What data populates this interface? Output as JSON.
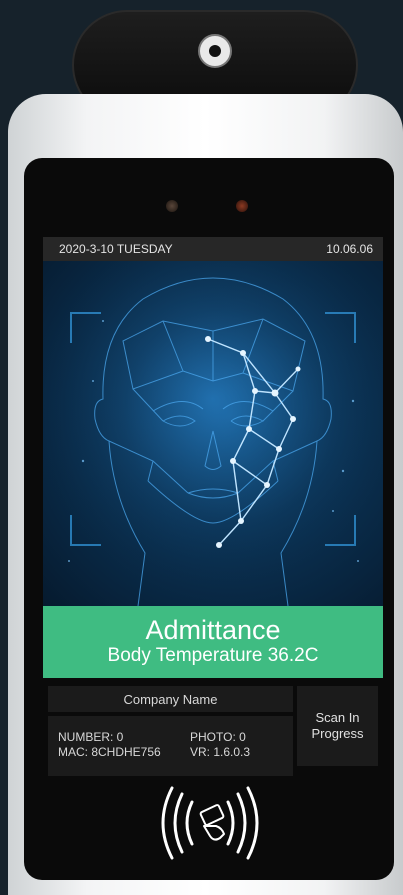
{
  "status_bar": {
    "date": "2020-3-10 TUESDAY",
    "time": "10.06.06"
  },
  "result": {
    "title": "Admittance",
    "subtitle": "Body Temperature 36.2C"
  },
  "info": {
    "company": "Company Name",
    "number": "NUMBER: 0",
    "photo": "PHOTO: 0",
    "mac": "MAC: 8CHDHE756",
    "version": "VR: 1.6.0.3"
  },
  "scan_status": {
    "line1": "Scan In",
    "line2": "Progress"
  },
  "colors": {
    "accent": "#3fbc82",
    "scan_bg": "#0b3457",
    "face_lines": "#5fb6ff"
  },
  "icons": {
    "camera": "camera-lens-icon",
    "nfc": "nfc-card-tap-icon"
  }
}
